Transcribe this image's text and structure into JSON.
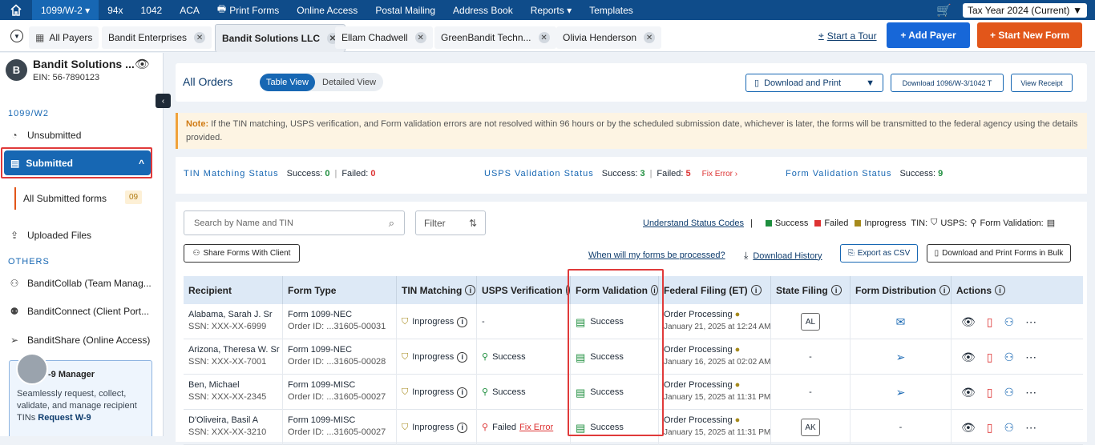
{
  "topnav": {
    "items": [
      "1099/W-2 ▾",
      "94x",
      "1042",
      "ACA",
      "Print Forms",
      "Online Access",
      "Postal Mailing",
      "Address Book",
      "Reports ▾",
      "Templates"
    ],
    "tax_year": "Tax Year 2024 (Current)"
  },
  "tabs": {
    "all_payers": "All Payers",
    "items": [
      "Bandit Enterprises",
      "Bandit Solutions LLC",
      "Ellam Chadwell",
      "GreenBandit Techn...",
      "Olivia Henderson"
    ],
    "start_tour": "Start a Tour",
    "add_payer": "+ Add Payer",
    "start_new_form": "+ Start New Form"
  },
  "sidebar": {
    "payer_initial": "B",
    "payer_name": "Bandit Solutions ...",
    "ein": "EIN: 56-7890123",
    "section1": "1099/W2",
    "unsubmitted": "Unsubmitted",
    "submitted": "Submitted",
    "all_submitted": "All Submitted forms",
    "all_submitted_count": "09",
    "uploaded": "Uploaded Files",
    "section2": "OTHERS",
    "collab": "BanditCollab (Team Manag...",
    "connect": "BanditConnect (Client Port...",
    "share": "BanditShare (Online Access)",
    "promo_title": "-9 Manager",
    "promo_text": "Seamlessly request, collect, validate, and manage recipient TINs ",
    "promo_link": "Request W-9"
  },
  "orders": {
    "title": "All Orders",
    "table_view": "Table View",
    "detailed_view": "Detailed View",
    "download_print": "Download and Print",
    "download_1096": "Download 1096/W-3/1042 T",
    "view_receipt": "View Receipt"
  },
  "note": {
    "label": "Note:",
    "text": " If the TIN matching, USPS verification, and Form validation errors are not resolved within 96 hours or by the scheduled submission date, whichever is later, the forms will be transmitted to the federal agency using the details provided."
  },
  "status": {
    "tin_label": "TIN Matching Status",
    "tin_success": "Success: 0",
    "tin_failed": "Failed: 0",
    "usps_label": "USPS Validation Status",
    "usps_success": "Success: 3",
    "usps_failed": "Failed: 5",
    "fix_error": "Fix Error ›",
    "form_label": "Form Validation Status",
    "form_success": "Success: 9"
  },
  "tools": {
    "search_placeholder": "Search by Name and TIN",
    "filter": "Filter",
    "understand": "Understand Status Codes",
    "legend_success": "Success",
    "legend_failed": "Failed",
    "legend_inprogress": "Inprogress",
    "tin": "TIN:",
    "usps": "USPS:",
    "form_validation": "Form Validation:",
    "share": "Share Forms With Client",
    "when": "When will my forms be processed?",
    "history": "Download History",
    "export": "Export as CSV",
    "bulk": "Download and Print Forms in Bulk"
  },
  "table": {
    "headers": [
      "Recipient",
      "Form Type",
      "TIN Matching",
      "USPS Verification",
      "Form Validation",
      "Federal Filing (ET)",
      "State Filing",
      "Form Distribution",
      "Actions"
    ],
    "rows": [
      {
        "name": "Alabama, Sarah J. Sr",
        "ssn": "SSN: XXX-XX-6999",
        "form": "Form 1099-NEC",
        "order": "Order ID:  ...31605-00031",
        "tin": "Inprogress",
        "usps": "-",
        "fv": "Success",
        "fed": "Order Processing",
        "date": "January 21, 2025 at 12:24 AM",
        "state": "AL"
      },
      {
        "name": "Arizona, Theresa W. Sr",
        "ssn": "SSN: XXX-XX-7001",
        "form": "Form 1099-NEC",
        "order": "Order ID:  ...31605-00028",
        "tin": "Inprogress",
        "usps": "Success",
        "fv": "Success",
        "fed": "Order Processing",
        "date": "January 16, 2025 at 02:02 AM",
        "state": "-"
      },
      {
        "name": "Ben, Michael",
        "ssn": "SSN: XXX-XX-2345",
        "form": "Form 1099-MISC",
        "order": "Order ID:  ...31605-00027",
        "tin": "Inprogress",
        "usps": "Success",
        "fv": "Success",
        "fed": "Order Processing",
        "date": "January 15, 2025 at 11:31 PM",
        "state": "-"
      },
      {
        "name": "D'Oliveira, Basil A",
        "ssn": "SSN: XXX-XX-3210",
        "form": "Form 1099-MISC",
        "order": "Order ID:  ...31605-00027",
        "tin": "Inprogress",
        "usps": "Failed",
        "usps_fix": "Fix Error",
        "fv": "Success",
        "fed": "Order Processing",
        "date": "January 15, 2025 at 11:31 PM",
        "state": "AK",
        "dist": "-"
      }
    ]
  }
}
